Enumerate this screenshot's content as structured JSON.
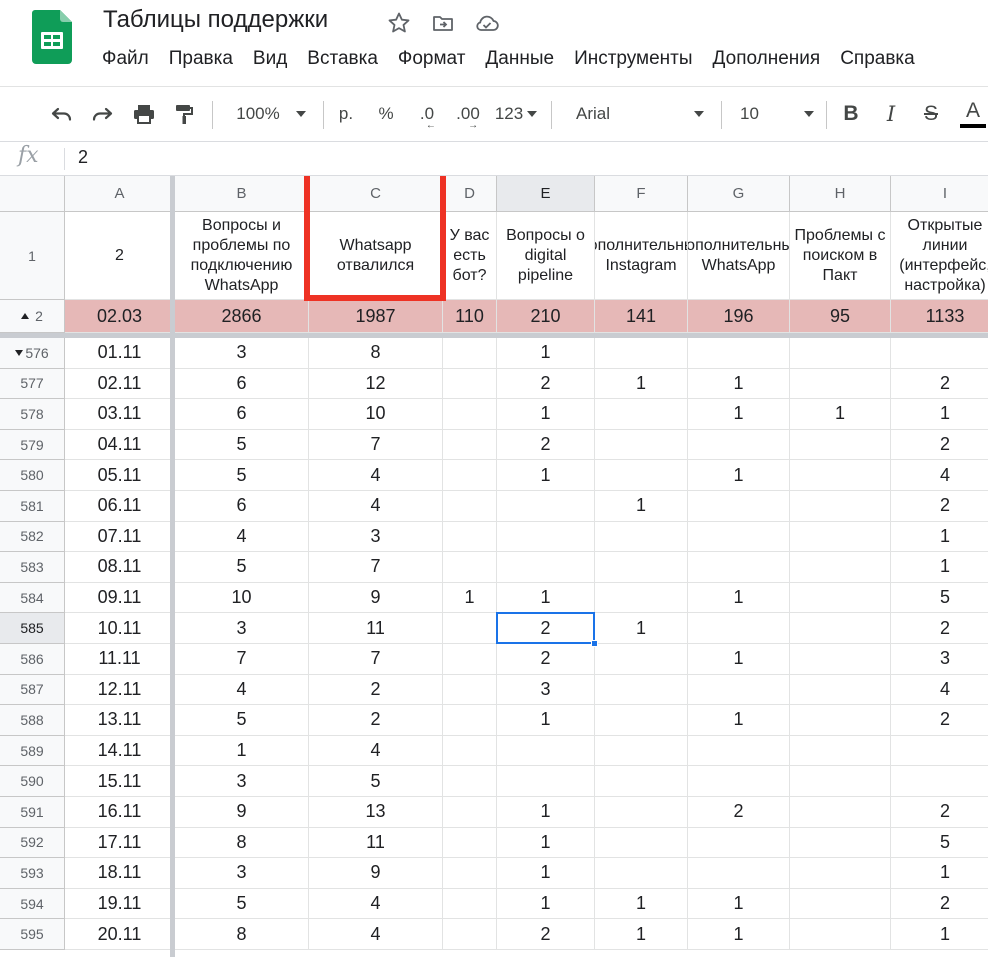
{
  "app": {
    "title": "Таблицы поддержки",
    "menu": [
      "Файл",
      "Правка",
      "Вид",
      "Вставка",
      "Формат",
      "Данные",
      "Инструменты",
      "Дополнения",
      "Справка"
    ],
    "icons": {
      "logo": "sheets-logo-icon",
      "star": "star-icon",
      "move": "move-to-folder-icon",
      "cloud": "cloud-saved-icon"
    }
  },
  "toolbar": {
    "zoom": "100%",
    "currency": "р.",
    "percent": "%",
    "decrease_decimals": ".0",
    "increase_decimals": ".00",
    "more_formats": "123",
    "font": "Arial",
    "font_size": "10",
    "bold": "B",
    "italic": "I",
    "strikethrough": "S",
    "text_color": "A"
  },
  "formula_bar": {
    "fx": "fx",
    "value": "2"
  },
  "grid": {
    "columns": [
      "A",
      "B",
      "C",
      "D",
      "E",
      "F",
      "G",
      "H",
      "I"
    ],
    "header_row": {
      "row_number": "1",
      "cells": [
        "2",
        "Вопросы и проблемы по подключению WhatsApp",
        "Whatsapp отвалился",
        "У вас есть бот?",
        "Вопросы о digital pipeline",
        "Дополнительный Instagram",
        "Дополнительный WhatsApp",
        "Проблемы с поиском в Пакт",
        "Открытые линии (интерфейс, настройка)"
      ]
    },
    "summary_row": {
      "row_number": "2",
      "cells": [
        "02.03",
        "2866",
        "1987",
        "110",
        "210",
        "141",
        "196",
        "95",
        "1133"
      ]
    },
    "rows": [
      {
        "n": "576",
        "cells": [
          "01.11",
          "3",
          "8",
          "",
          "1",
          "",
          "",
          "",
          ""
        ]
      },
      {
        "n": "577",
        "cells": [
          "02.11",
          "6",
          "12",
          "",
          "2",
          "1",
          "1",
          "",
          "2"
        ]
      },
      {
        "n": "578",
        "cells": [
          "03.11",
          "6",
          "10",
          "",
          "1",
          "",
          "1",
          "1",
          "1"
        ]
      },
      {
        "n": "579",
        "cells": [
          "04.11",
          "5",
          "7",
          "",
          "2",
          "",
          "",
          "",
          "2"
        ]
      },
      {
        "n": "580",
        "cells": [
          "05.11",
          "5",
          "4",
          "",
          "1",
          "",
          "1",
          "",
          "4"
        ]
      },
      {
        "n": "581",
        "cells": [
          "06.11",
          "6",
          "4",
          "",
          "",
          "1",
          "",
          "",
          "2"
        ]
      },
      {
        "n": "582",
        "cells": [
          "07.11",
          "4",
          "3",
          "",
          "",
          "",
          "",
          "",
          "1"
        ]
      },
      {
        "n": "583",
        "cells": [
          "08.11",
          "5",
          "7",
          "",
          "",
          "",
          "",
          "",
          "1"
        ]
      },
      {
        "n": "584",
        "cells": [
          "09.11",
          "10",
          "9",
          "1",
          "1",
          "",
          "1",
          "",
          "5"
        ]
      },
      {
        "n": "585",
        "cells": [
          "10.11",
          "3",
          "11",
          "",
          "2",
          "1",
          "",
          "",
          "2"
        ]
      },
      {
        "n": "586",
        "cells": [
          "11.11",
          "7",
          "7",
          "",
          "2",
          "",
          "1",
          "",
          "3"
        ]
      },
      {
        "n": "587",
        "cells": [
          "12.11",
          "4",
          "2",
          "",
          "3",
          "",
          "",
          "",
          "4"
        ]
      },
      {
        "n": "588",
        "cells": [
          "13.11",
          "5",
          "2",
          "",
          "1",
          "",
          "1",
          "",
          "2"
        ]
      },
      {
        "n": "589",
        "cells": [
          "14.11",
          "1",
          "4",
          "",
          "",
          "",
          "",
          "",
          ""
        ]
      },
      {
        "n": "590",
        "cells": [
          "15.11",
          "3",
          "5",
          "",
          "",
          "",
          "",
          "",
          ""
        ]
      },
      {
        "n": "591",
        "cells": [
          "16.11",
          "9",
          "13",
          "",
          "1",
          "",
          "2",
          "",
          "2"
        ]
      },
      {
        "n": "592",
        "cells": [
          "17.11",
          "8",
          "11",
          "",
          "1",
          "",
          "",
          "",
          "5"
        ]
      },
      {
        "n": "593",
        "cells": [
          "18.11",
          "3",
          "9",
          "",
          "1",
          "",
          "",
          "",
          "1"
        ]
      },
      {
        "n": "594",
        "cells": [
          "19.11",
          "5",
          "4",
          "",
          "1",
          "1",
          "1",
          "",
          "2"
        ]
      },
      {
        "n": "595",
        "cells": [
          "20.11",
          "8",
          "4",
          "",
          "2",
          "1",
          "1",
          "",
          "1"
        ]
      }
    ],
    "selected_cell": "E585",
    "highlighted_column": "C",
    "colors": {
      "summary_fill": "#e6b8b7",
      "selection": "#1a73e8",
      "highlight": "#ee3224"
    }
  }
}
